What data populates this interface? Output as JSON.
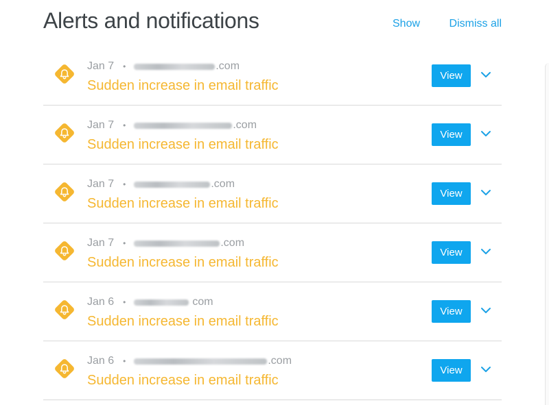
{
  "header": {
    "title": "Alerts and notifications",
    "show_label": "Show",
    "dismiss_all_label": "Dismiss all"
  },
  "colors": {
    "alert_accent": "#f5b731",
    "link": "#1ba1e6",
    "button": "#0fa6ee",
    "title_text": "#3d4347",
    "meta_text": "#9a9ea2"
  },
  "alerts": [
    {
      "date": "Jan 7",
      "separator": "•",
      "domain_suffix": ".com",
      "title": "Sudden increase in email traffic",
      "view_label": "View",
      "icon": "bell-icon",
      "expand_icon": "chevron-down-icon"
    },
    {
      "date": "Jan 7",
      "separator": "•",
      "domain_suffix": ".com",
      "title": "Sudden increase in email traffic",
      "view_label": "View",
      "icon": "bell-icon",
      "expand_icon": "chevron-down-icon"
    },
    {
      "date": "Jan 7",
      "separator": "•",
      "domain_suffix": ".com",
      "title": "Sudden increase in email traffic",
      "view_label": "View",
      "icon": "bell-icon",
      "expand_icon": "chevron-down-icon"
    },
    {
      "date": "Jan 7",
      "separator": "•",
      "domain_suffix": ".com",
      "title": "Sudden increase in email traffic",
      "view_label": "View",
      "icon": "bell-icon",
      "expand_icon": "chevron-down-icon"
    },
    {
      "date": "Jan 6",
      "separator": "•",
      "domain_suffix": "com",
      "title": "Sudden increase in email traffic",
      "view_label": "View",
      "icon": "bell-icon",
      "expand_icon": "chevron-down-icon"
    },
    {
      "date": "Jan 6",
      "separator": "•",
      "domain_suffix": ".com",
      "title": "Sudden increase in email traffic",
      "view_label": "View",
      "icon": "bell-icon",
      "expand_icon": "chevron-down-icon"
    }
  ]
}
